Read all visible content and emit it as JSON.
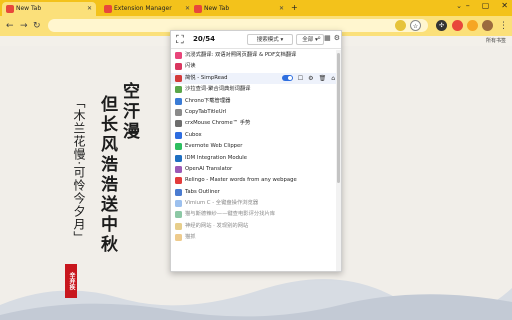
{
  "tabs": [
    {
      "label": "New Tab",
      "active": true
    },
    {
      "label": "Extension Manager",
      "active": false
    },
    {
      "label": "New Tab",
      "active": false
    }
  ],
  "toolbar": {
    "new_tab": "+",
    "bookmarks_all": "所有书签"
  },
  "poem": {
    "col_a": "空汗漫",
    "col_b": "但长风浩浩送中秋",
    "col_c": "「木兰花慢·可怜今夕月」",
    "seal": "辛弃疾"
  },
  "popup": {
    "count": "20/54",
    "mode_label": "搜索模式 ▾",
    "filter_label": "全部 ▾",
    "extensions": [
      {
        "name": "沉浸式翻译: 双语对照网页翻译 & PDF文档翻译",
        "color": "#e8457a",
        "enabled": true
      },
      {
        "name": "闪读",
        "color": "#d9365f",
        "enabled": true
      },
      {
        "name": "简悦 - SimpRead",
        "color": "#d33b3b",
        "enabled": true,
        "highlight": true
      },
      {
        "name": "沙拉查词-聚合词典划词翻译",
        "color": "#5aa64a",
        "enabled": true
      },
      {
        "name": "Chrono下载管理器",
        "color": "#3a7bd5",
        "enabled": true
      },
      {
        "name": "CopyTabTitleUrl",
        "color": "#8a8a8a",
        "enabled": true
      },
      {
        "name": "crxMouse Chrome™ 手势",
        "color": "#6d6d6d",
        "enabled": true
      },
      {
        "name": "Cubox",
        "color": "#2e6de0",
        "enabled": true
      },
      {
        "name": "Evernote Web Clipper",
        "color": "#2dbe60",
        "enabled": true
      },
      {
        "name": "IDM Integration Module",
        "color": "#1f6fc1",
        "enabled": true
      },
      {
        "name": "OpenAI Translator",
        "color": "#9b59b6",
        "enabled": true
      },
      {
        "name": "Relingo - Master words from any webpage",
        "color": "#e23b3b",
        "enabled": true
      },
      {
        "name": "Tabs Outliner",
        "color": "#4a7bd0",
        "enabled": true
      },
      {
        "name": "Vimium C - 全键盘操作浏览器",
        "color": "#4b8de0",
        "enabled": false
      },
      {
        "name": "猫与斯德辣纱——键查电影评分找片库",
        "color": "#2d9a5b",
        "enabled": false
      },
      {
        "name": "神经的网站 · 发现别的网站",
        "color": "#d4a52b",
        "enabled": false
      },
      {
        "name": "猫抓",
        "color": "#e0a030",
        "enabled": false
      }
    ]
  },
  "colors": {
    "tab_strip": "#f3c21b",
    "toolbar": "#fbe07a",
    "seal": "#c8161d",
    "toggle_on": "#2f6fe0"
  }
}
